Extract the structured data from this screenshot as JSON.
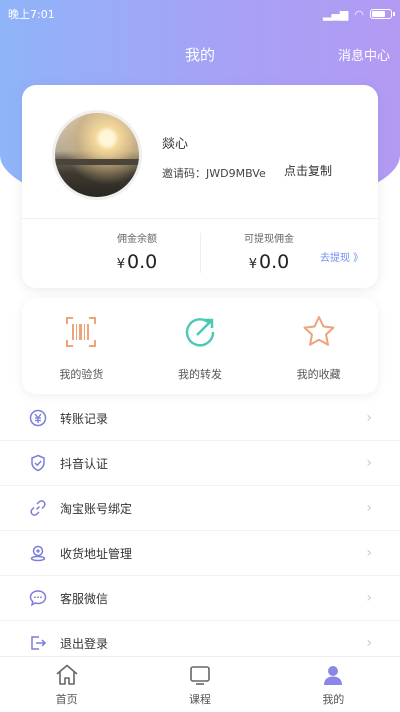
{
  "status_bar": {
    "time": "晚上7:01"
  },
  "header": {
    "title": "我的",
    "message_center": "消息中心"
  },
  "profile": {
    "name": "燚心",
    "invite_code_label": "邀请码：",
    "invite_code": "JWD9MBVe",
    "copy_label": "点击复制",
    "balance_label": "佣金余额",
    "balance_value": "0.0",
    "withdrawable_label": "可提现佣金",
    "withdrawable_value": "0.0",
    "currency": "¥",
    "withdraw_link": "去提现 》"
  },
  "shortcuts": [
    {
      "label": "我的验货",
      "icon": "barcode-scan-icon"
    },
    {
      "label": "我的转发",
      "icon": "share-forward-icon"
    },
    {
      "label": "我的收藏",
      "icon": "star-icon"
    }
  ],
  "menu": [
    {
      "label": "转账记录",
      "icon": "transfer-record-icon"
    },
    {
      "label": "抖音认证",
      "icon": "shield-check-icon"
    },
    {
      "label": "淘宝账号绑定",
      "icon": "link-icon"
    },
    {
      "label": "收货地址管理",
      "icon": "location-icon"
    },
    {
      "label": "客服微信",
      "icon": "chat-icon"
    },
    {
      "label": "退出登录",
      "icon": "logout-icon"
    }
  ],
  "tabs": [
    {
      "label": "首页",
      "icon": "home-icon"
    },
    {
      "label": "课程",
      "icon": "course-icon"
    },
    {
      "label": "我的",
      "icon": "profile-icon"
    }
  ],
  "colors": {
    "accent": "#6f8ff0",
    "gradient_start": "#8fb4f8",
    "gradient_end": "#b39af3",
    "icon_purple": "#7b7fd6",
    "icon_orange": "#f0a27a",
    "icon_teal": "#4cc9b5"
  }
}
